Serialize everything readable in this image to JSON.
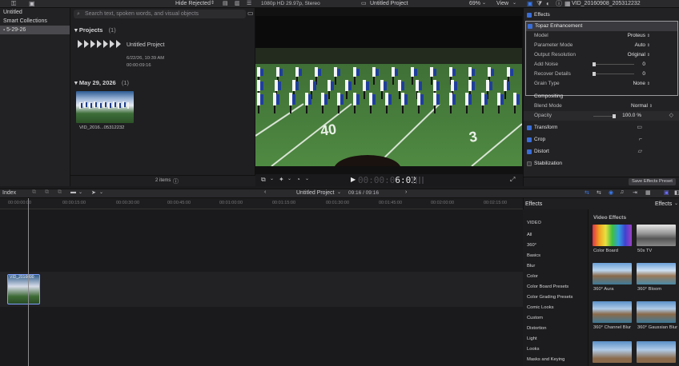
{
  "toolbar": {
    "hide_rejected": "Hide Rejected",
    "format": "1080p HD 29.97p, Stereo",
    "project_title": "Untitled Project",
    "zoom": "69%",
    "view": "View"
  },
  "sidebar": {
    "items": [
      {
        "label": "Untitled"
      },
      {
        "label": "Smart Collections"
      },
      {
        "label": "5-29-26"
      }
    ]
  },
  "browser": {
    "search_placeholder": "Search text, spoken words, and visual objects",
    "projects_heading": "Projects",
    "projects_count": "(1)",
    "project_name": "Untitled Project",
    "project_date": "6/22/26, 10:39 AM",
    "project_duration": "00:00:09:16",
    "date_heading": "May 29, 2026",
    "date_count": "(1)",
    "clip_name": "VID_2016...05312232",
    "items_count": "2 items"
  },
  "viewer": {
    "timecode_dim": "00:00:0",
    "timecode": "6:02"
  },
  "inspector": {
    "clip_name": "VID_20160908_205312232",
    "effects_label": "Effects",
    "topaz_label": "Topaz Enhancement",
    "rows": [
      {
        "label": "Model",
        "value": "Proteus"
      },
      {
        "label": "Parameter Mode",
        "value": "Auto"
      },
      {
        "label": "Output Resolution",
        "value": "Original"
      },
      {
        "label": "Add Noise",
        "value": "0"
      },
      {
        "label": "Recover Details",
        "value": "0"
      },
      {
        "label": "Grain Type",
        "value": "None"
      }
    ],
    "compositing_label": "Compositing",
    "blend_mode_label": "Blend Mode",
    "blend_mode_value": "Normal",
    "opacity_label": "Opacity",
    "opacity_value": "100.0 %",
    "transform_label": "Transform",
    "crop_label": "Crop",
    "distort_label": "Distort",
    "stabilization_label": "Stabilization",
    "save_preset": "Save Effects Preset"
  },
  "timeline": {
    "index_label": "Index",
    "project_title": "Untitled Project",
    "position": "09:16 / 09:16",
    "ticks": [
      "00:00:00:00",
      "00:00:15:00",
      "00:00:30:00",
      "00:00:45:00",
      "00:01:00:00",
      "00:01:15:00",
      "00:01:30:00",
      "00:01:45:00",
      "00:02:00:00",
      "00:02:15:00"
    ],
    "clip_label": "VID_2016090"
  },
  "effects_browser": {
    "title": "Effects",
    "dropdown": "Effects",
    "section_video": "VIDEO",
    "categories": [
      "All",
      "360°",
      "Basics",
      "Blur",
      "Color",
      "Color Board Presets",
      "Color Grading Presets",
      "Comic Looks",
      "Custom",
      "Distortion",
      "Light",
      "Looks",
      "Masks and Keying"
    ],
    "grid_heading": "Video Effects",
    "effects": [
      {
        "label": "Color Board"
      },
      {
        "label": "50s TV"
      },
      {
        "label": "360° Aura"
      },
      {
        "label": "360° Bloom"
      },
      {
        "label": "360° Channel Blur"
      },
      {
        "label": "360° Gaussian Blur"
      }
    ]
  }
}
